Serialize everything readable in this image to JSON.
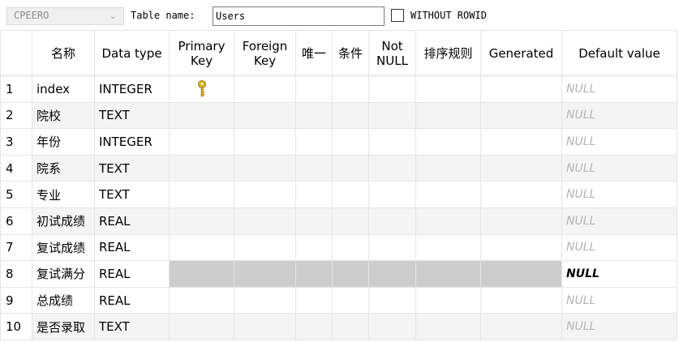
{
  "toolbar": {
    "schema_value": "CPEERO",
    "table_name_label": "Table name:",
    "table_name_value": "Users",
    "without_rowid_label": "WITHOUT ROWID"
  },
  "grid": {
    "headers": {
      "name": "名称",
      "data_type": "Data type",
      "primary_key": "Primary Key",
      "foreign_key": "Foreign Key",
      "unique": "唯一",
      "check": "条件",
      "not_null": "Not NULL",
      "collation": "排序规则",
      "generated": "Generated",
      "default_value": "Default value"
    },
    "rows": [
      {
        "num": "1",
        "name": "index",
        "type": "INTEGER",
        "primary_key": true,
        "default": "NULL"
      },
      {
        "num": "2",
        "name": "院校",
        "type": "TEXT",
        "default": "NULL"
      },
      {
        "num": "3",
        "name": "年份",
        "type": "INTEGER",
        "default": "NULL"
      },
      {
        "num": "4",
        "name": "院系",
        "type": "TEXT",
        "default": "NULL"
      },
      {
        "num": "5",
        "name": "专业",
        "type": "TEXT",
        "default": "NULL"
      },
      {
        "num": "6",
        "name": "初试成绩",
        "type": "REAL",
        "default": "NULL"
      },
      {
        "num": "7",
        "name": "复试成绩",
        "type": "REAL",
        "default": "NULL"
      },
      {
        "num": "8",
        "name": "复试满分",
        "type": "REAL",
        "default": "NULL"
      },
      {
        "num": "9",
        "name": "总成绩",
        "type": "REAL",
        "default": "NULL"
      },
      {
        "num": "10",
        "name": "是否录取",
        "type": "TEXT",
        "default": "NULL"
      }
    ],
    "selected_row": 8
  }
}
